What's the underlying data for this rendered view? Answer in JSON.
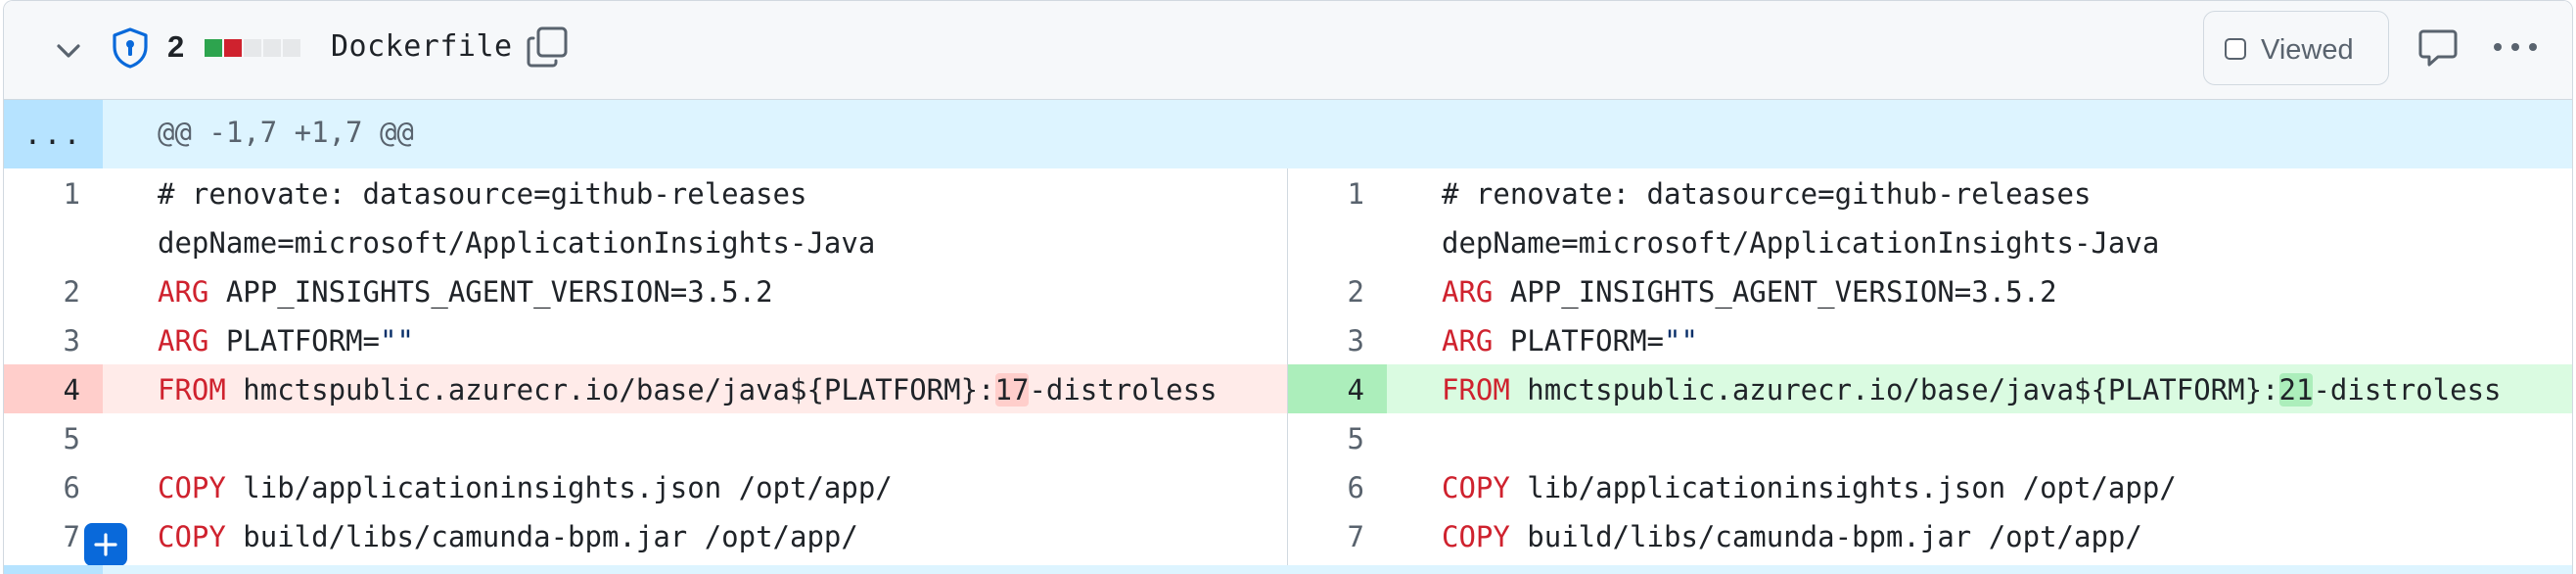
{
  "file": {
    "changed_count": "2",
    "name": "Dockerfile",
    "diffstat": [
      "#2da44e",
      "#cf222e",
      "#e6e8ea",
      "#e6e8ea",
      "#e6e8ea"
    ],
    "icons": {
      "collapse": "chevron-down-icon",
      "owner": "shield-icon",
      "copy": "copy-icon",
      "comment": "comment-icon",
      "more": "kebab-horizontal-icon",
      "add_comment": "plus-icon"
    }
  },
  "actions": {
    "viewed_label": "Viewed",
    "viewed_checked": false
  },
  "hunk": {
    "expander": "...",
    "header": "@@ -1,7 +1,7 @@"
  },
  "left": {
    "rows": [
      {
        "num": "1",
        "lines": [
          "# renovate: datasource=github-releases ",
          "depName=microsoft/ApplicationInsights-Java"
        ]
      },
      {
        "num": "2",
        "kw": "ARG",
        "rest": " APP_INSIGHTS_AGENT_VERSION=3.5.2"
      },
      {
        "num": "3",
        "kw": "ARG",
        "rest": " PLATFORM=",
        "str": "\"\""
      },
      {
        "num": "4",
        "kw": "FROM",
        "before": " hmctspublic.azurecr.io/base/java${PLATFORM}:",
        "changed": "17",
        "after": "-distroless"
      },
      {
        "num": "5"
      },
      {
        "num": "6",
        "kw": "COPY",
        "rest": " lib/applicationinsights.json /opt/app/"
      },
      {
        "num": "7",
        "kw": "COPY",
        "rest": " build/libs/camunda-bpm.jar /opt/app/"
      }
    ]
  },
  "right": {
    "rows": [
      {
        "num": "1",
        "lines": [
          "# renovate: datasource=github-releases ",
          "depName=microsoft/ApplicationInsights-Java"
        ]
      },
      {
        "num": "2",
        "kw": "ARG",
        "rest": " APP_INSIGHTS_AGENT_VERSION=3.5.2"
      },
      {
        "num": "3",
        "kw": "ARG",
        "rest": " PLATFORM=",
        "str": "\"\""
      },
      {
        "num": "4",
        "kw": "FROM",
        "before": " hmctspublic.azurecr.io/base/java${PLATFORM}:",
        "changed": "21",
        "after": "-distroless"
      },
      {
        "num": "5"
      },
      {
        "num": "6",
        "kw": "COPY",
        "rest": " lib/applicationinsights.json /opt/app/"
      },
      {
        "num": "7",
        "kw": "COPY",
        "rest": " build/libs/camunda-bpm.jar /opt/app/"
      }
    ]
  }
}
